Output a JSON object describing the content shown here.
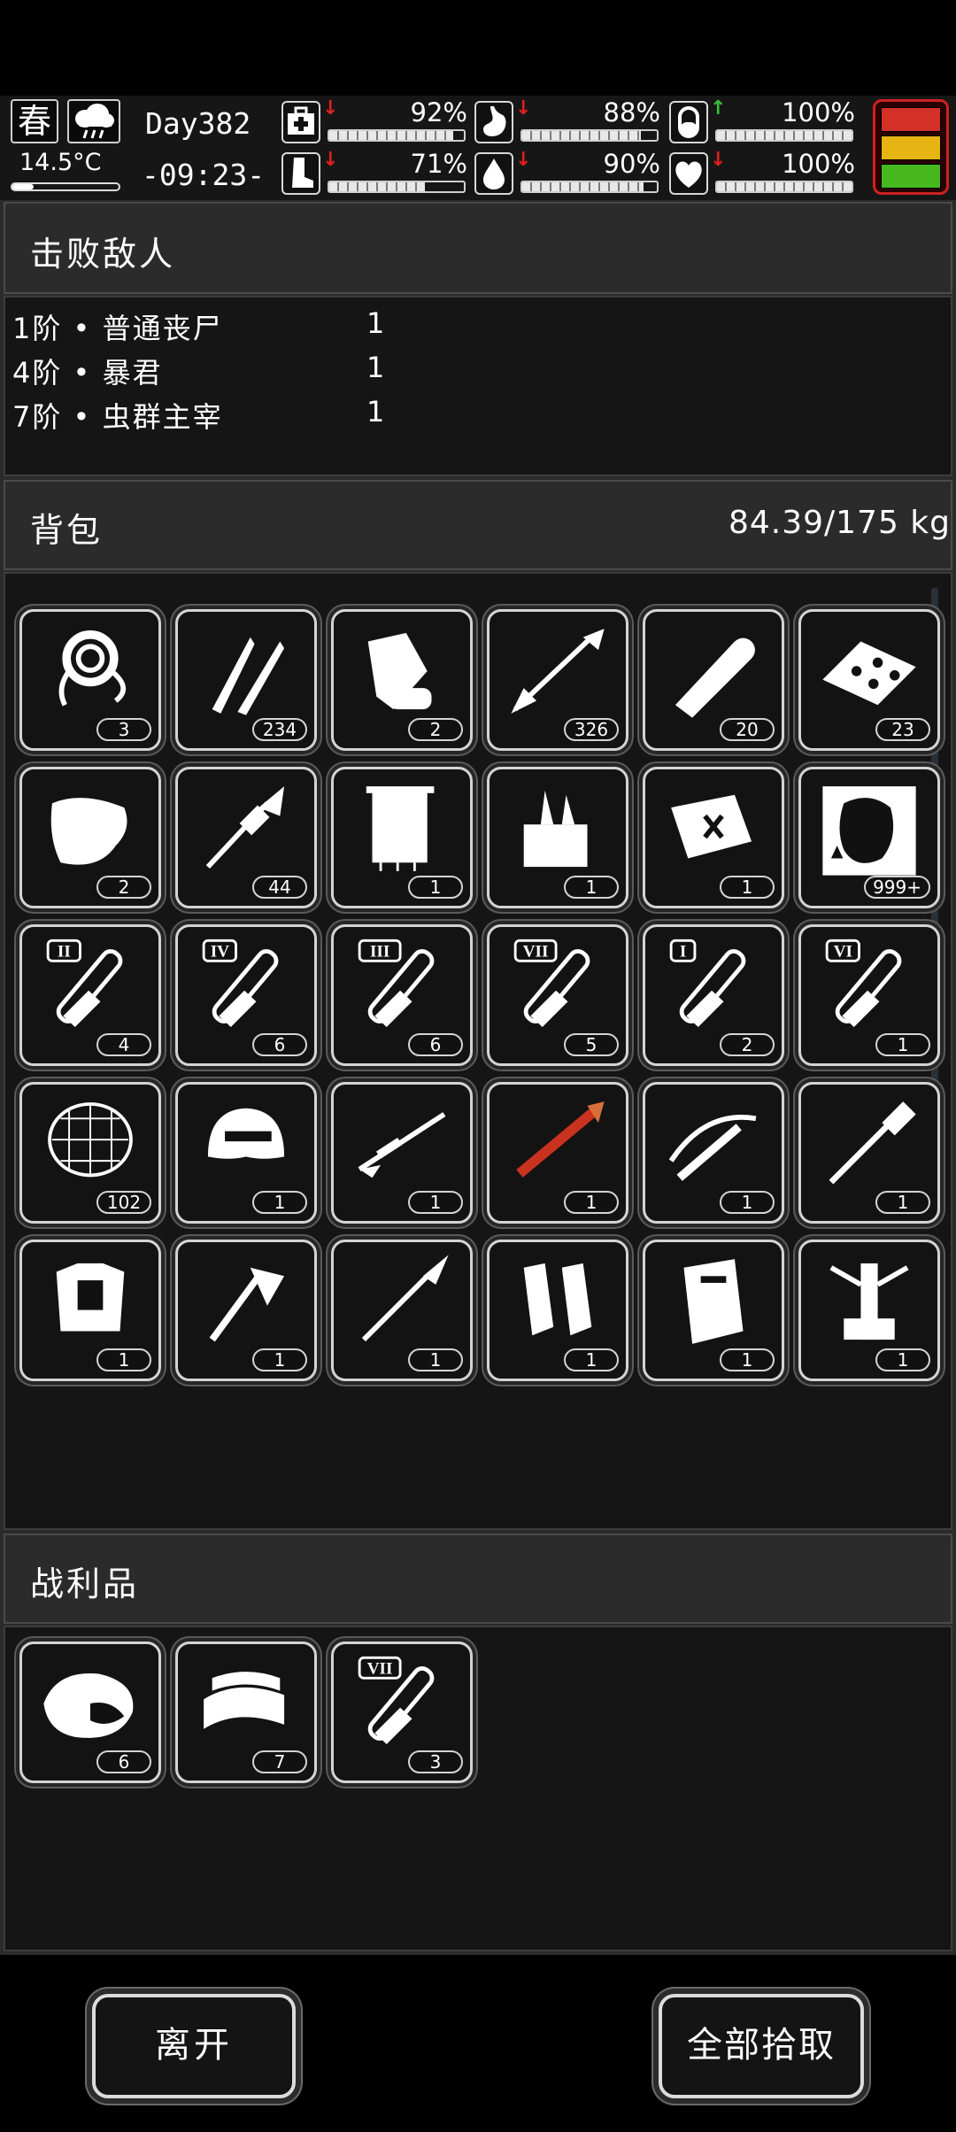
{
  "status": {
    "season": "春",
    "weather_icon": "cloud-rain-icon",
    "temperature": "14.5°C",
    "temperature_level": 0.2,
    "day": "Day382",
    "time": "-09:23-",
    "stats": [
      {
        "icon": "medkit-icon",
        "trend": "down",
        "value": "92%",
        "level": 0.92
      },
      {
        "icon": "stomach-icon",
        "trend": "down",
        "value": "88%",
        "level": 0.88
      },
      {
        "icon": "pill-icon",
        "trend": "up",
        "value": "100%",
        "level": 1.0
      },
      {
        "icon": "boot-icon",
        "trend": "down",
        "value": "71%",
        "level": 0.71
      },
      {
        "icon": "water-drop-icon",
        "trend": "down",
        "value": "90%",
        "level": 0.9
      },
      {
        "icon": "heart-icon",
        "trend": "down",
        "value": "100%",
        "level": 1.0
      }
    ],
    "danger_colors": [
      "#d33127",
      "#e6b514",
      "#46b81e"
    ]
  },
  "defeated": {
    "title": "击败敌人",
    "enemies": [
      {
        "name": "1阶 • 普通丧尸",
        "count": "1"
      },
      {
        "name": "4阶 • 暴君",
        "count": "1"
      },
      {
        "name": "7阶 • 虫群主宰",
        "count": "1"
      }
    ]
  },
  "backpack": {
    "title": "背包",
    "weight": "84.39/175 kg",
    "items": [
      {
        "icon": "rope-icon",
        "count": "3"
      },
      {
        "icon": "bullets-icon",
        "count": "234"
      },
      {
        "icon": "scroll-map-icon",
        "count": "2"
      },
      {
        "icon": "arrow-icon",
        "count": "326"
      },
      {
        "icon": "bandage-roll-icon",
        "count": "20"
      },
      {
        "icon": "crackers-icon",
        "count": "23"
      },
      {
        "icon": "cloth-icon",
        "count": "2"
      },
      {
        "icon": "rpg-rocket-icon",
        "count": "44"
      },
      {
        "icon": "towel-icon",
        "count": "1"
      },
      {
        "icon": "toolbox-icon",
        "count": "1"
      },
      {
        "icon": "repair-kit-icon",
        "count": "1"
      },
      {
        "icon": "zombie-card-icon",
        "count": "999+"
      },
      {
        "icon": "serum-tube-icon",
        "tier": "II",
        "count": "4"
      },
      {
        "icon": "serum-tube-icon",
        "tier": "IV",
        "count": "6"
      },
      {
        "icon": "serum-tube-icon",
        "tier": "III",
        "count": "6"
      },
      {
        "icon": "serum-tube-icon",
        "tier": "VII",
        "count": "5"
      },
      {
        "icon": "serum-tube-icon",
        "tier": "I",
        "count": "2"
      },
      {
        "icon": "serum-tube-icon",
        "tier": "VI",
        "count": "1"
      },
      {
        "icon": "net-icon",
        "count": "102"
      },
      {
        "icon": "helmet-icon",
        "count": "1"
      },
      {
        "icon": "sniper-rifle-icon",
        "count": "1"
      },
      {
        "icon": "rocket-launcher-icon",
        "count": "1"
      },
      {
        "icon": "crossbow-icon",
        "count": "1"
      },
      {
        "icon": "shovel-icon",
        "count": "1"
      },
      {
        "icon": "body-armor-icon",
        "count": "1"
      },
      {
        "icon": "axe-icon",
        "count": "1"
      },
      {
        "icon": "spear-icon",
        "count": "1"
      },
      {
        "icon": "shin-guards-icon",
        "count": "1"
      },
      {
        "icon": "riot-shield-icon",
        "count": "1"
      },
      {
        "icon": "exoskeleton-icon",
        "count": "1"
      }
    ]
  },
  "loot": {
    "title": "战利品",
    "items": [
      {
        "icon": "meat-icon",
        "count": "6"
      },
      {
        "icon": "fabric-icon",
        "count": "7"
      },
      {
        "icon": "serum-tube-icon",
        "tier": "VII",
        "count": "3"
      }
    ]
  },
  "buttons": {
    "leave": "离开",
    "pickup_all": "全部拾取"
  }
}
